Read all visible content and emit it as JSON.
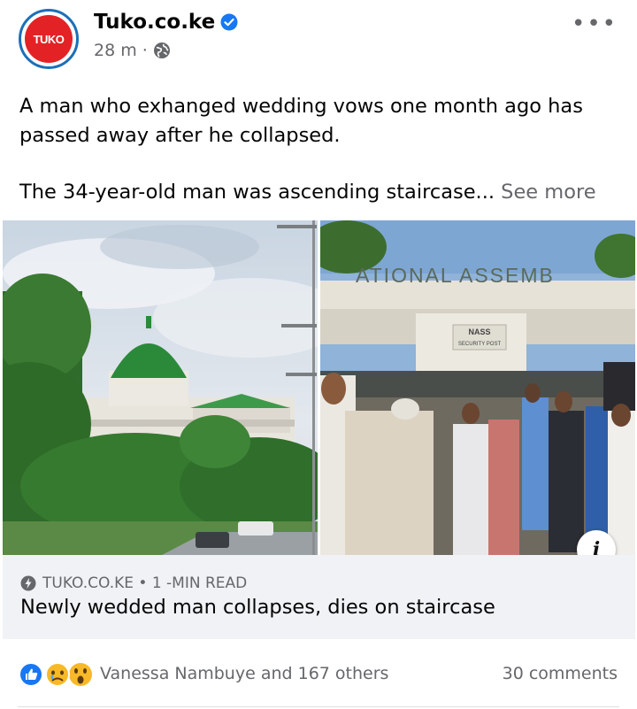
{
  "post": {
    "page_name": "Tuko.co.ke",
    "avatar_text": "TUKO",
    "time": "28 m",
    "separator": "·",
    "more_label": "•••",
    "text_line1": "A man who exhanged wedding vows one month ago has passed away after he collapsed.",
    "text_line2": "The 34-year-old man was ascending staircase...",
    "see_more": "See more"
  },
  "images": {
    "right_sign": "ATIONAL ASSEMB",
    "right_post": "NASS",
    "right_post_sub": "SECURITY POST",
    "info_label": "i"
  },
  "link_card": {
    "source": "TUKO.CO.KE • 1 -MIN READ",
    "title": "Newly wedded man collapses, dies on staircase"
  },
  "reactions": {
    "reactors": "Vanessa Nambuye and 167 others",
    "comments": "30 comments"
  },
  "colors": {
    "brand_blue": "#1877f2",
    "tuko_red": "#e32226",
    "muted_text": "#65676b",
    "card_bg": "#f0f2f5"
  },
  "icons": [
    "verified-badge-icon",
    "globe-icon",
    "more-options-icon",
    "bolt-icon",
    "info-icon",
    "like-reaction-icon",
    "sad-reaction-icon",
    "wow-reaction-icon"
  ]
}
